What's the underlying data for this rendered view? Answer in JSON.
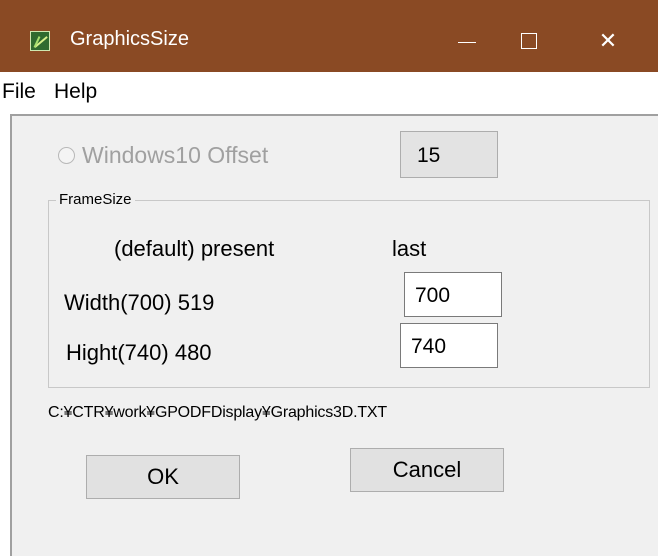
{
  "window": {
    "title": "GraphicsSize",
    "controls": {
      "minimize": "—",
      "close": "✕"
    }
  },
  "menu": {
    "items": [
      "File",
      "Help"
    ]
  },
  "offset": {
    "label": "Windows10 Offset",
    "value": "15"
  },
  "frame": {
    "legend": "FrameSize",
    "headers": {
      "default_present": "(default)  present",
      "last": "last"
    },
    "width": {
      "label": "Width(700)  519",
      "value": "700"
    },
    "height": {
      "label": "Hight(740)  480",
      "value": "740"
    }
  },
  "path": "C:¥CTR¥work¥GPODFDisplay¥Graphics3D.TXT",
  "buttons": {
    "ok": "OK",
    "cancel": "Cancel"
  }
}
